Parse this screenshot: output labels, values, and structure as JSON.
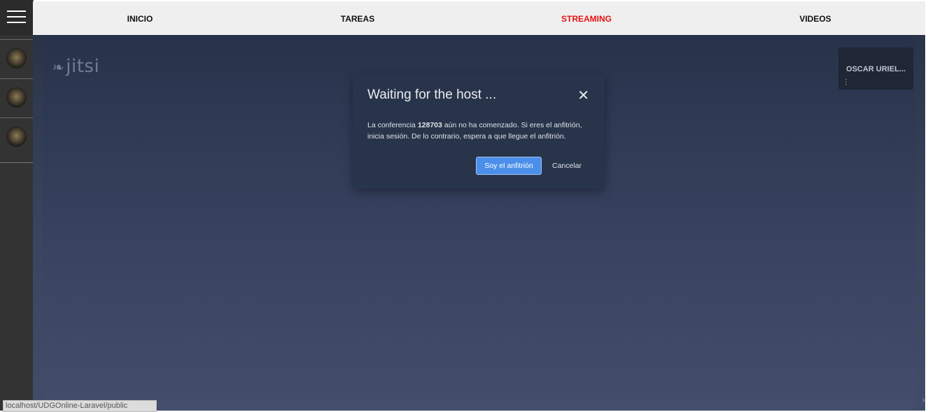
{
  "nav": {
    "items": [
      {
        "label": "INICIO"
      },
      {
        "label": "TAREAS"
      },
      {
        "label": "STREAMING"
      },
      {
        "label": "VIDEOS"
      }
    ],
    "active_color": "#e51414"
  },
  "sidebar": {
    "menu_icon": "hamburger-icon",
    "items": [
      {
        "icon": "avatar-icon"
      },
      {
        "icon": "avatar-icon"
      },
      {
        "icon": "avatar-icon"
      }
    ]
  },
  "jitsi": {
    "logo_text": "jitsi",
    "participant_name": "OSCAR URIEL...",
    "thumb_menu_icon": "more-vertical-icon"
  },
  "dialog": {
    "title": "Waiting for the host ...",
    "body_prefix": "La conferencia ",
    "conference_id": "128703",
    "body_suffix": " aún no ha comenzado. Si eres el anfitrión, inicia sesión. De lo contrario, espera a que llegue el anfitrión.",
    "primary_button": "Soy el anfitrión",
    "cancel_button": "Cancelar",
    "close_icon": "close-icon"
  },
  "status_bar": {
    "url": "localhost/UDGOnline-Laravel/public"
  },
  "colors": {
    "dialog_bg": "#28344a",
    "primary": "#4c8fea"
  }
}
